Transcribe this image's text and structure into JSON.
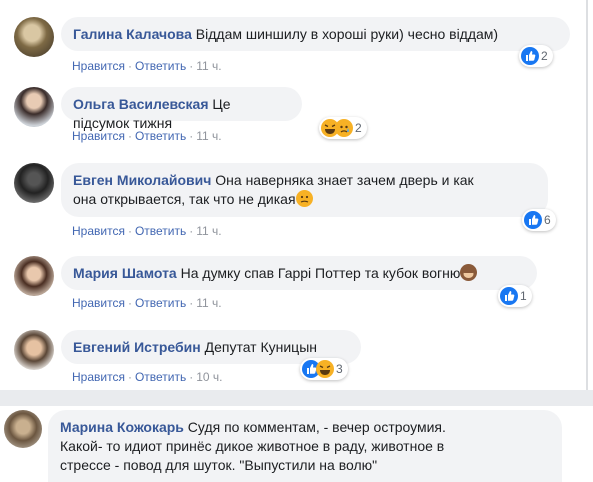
{
  "actions": {
    "like": "Нравится",
    "reply": "Ответить",
    "sep": "·"
  },
  "comments": [
    {
      "author": "Галина Калачова",
      "text": "Віддам шиншилу в хороші руки) чесно віддам)",
      "time": "11 ч.",
      "reactions": "2"
    },
    {
      "author": "Ольга Василевская",
      "text": "Це підсумок тижня",
      "time": "11 ч.",
      "reactions": "2"
    },
    {
      "author": "Евген Миколайович",
      "text_line1": "Она наверняка знает зачем дверь и как",
      "text_line2": "она открывается, так что не дикая",
      "time": "11 ч.",
      "reactions": "6"
    },
    {
      "author": "Мария Шамота",
      "text": "На думку спав Гаррі Поттер та кубок вогню",
      "time": "11 ч.",
      "reactions": "1"
    },
    {
      "author": "Евгений Истребин",
      "text": "Депутат Куницын",
      "time": "10 ч.",
      "reactions": "3"
    },
    {
      "author": "Марина Кожокарь",
      "text_line1": "Судя по комментам, - вечер остроумия.",
      "text_line2": "Какой- то идиот принёс дикое животное в раду, животное в",
      "text_line3": "стрессе - повод для шуток. \"Выпустили на волю\""
    }
  ]
}
